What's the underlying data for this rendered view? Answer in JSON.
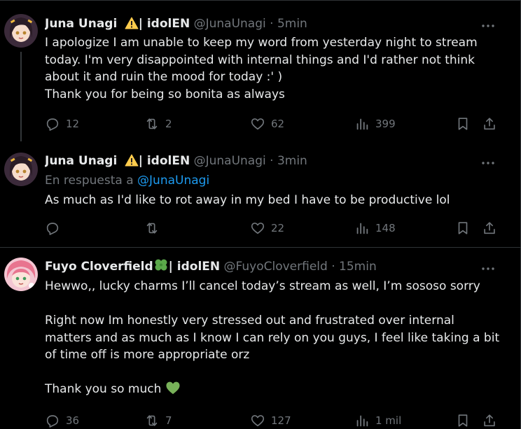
{
  "tweets": [
    {
      "name": "Juna Unagi",
      "name_suffix": "| idolEN",
      "handle": "@JunaUnagi",
      "dot": "·",
      "time": "5min",
      "lines": [
        "I apologize I am unable to keep my word from yesterday night to stream",
        "today. I'm very disappointed with internal things and I'd rather not think",
        "about it and ruin the mood for today :' )",
        "Thank you for being so bonita as always"
      ],
      "replies": "12",
      "retweets": "2",
      "likes": "62",
      "views": "399"
    },
    {
      "name": "Juna Unagi",
      "name_suffix": "| idolEN",
      "handle": "@JunaUnagi",
      "dot": "·",
      "time": "3min",
      "reply_prefix": "En respuesta a",
      "reply_handle": "@JunaUnagi",
      "lines": [
        "As much as I'd like to rot away in my bed I have to be productive lol"
      ],
      "replies": "",
      "retweets": "",
      "likes": "22",
      "views": "148"
    },
    {
      "name": "Fuyo Cloverfield",
      "name_suffix": "| idolEN",
      "handle": "@FuyoCloverfield",
      "dot": "·",
      "time": "15min",
      "line1": "Hewwo,, lucky charms I’ll cancel today’s stream as well, I’m sososo sorry",
      "line2": "Right now Im honestly very stressed out and frustrated over internal",
      "line3": "matters and as much as I know I can rely on you guys, I feel like taking a bit",
      "line4": "of time off is more appropriate orz",
      "line5": "Thank you so much",
      "replies": "36",
      "retweets": "7",
      "likes": "127",
      "views": "1 mil"
    }
  ],
  "colors": {
    "background": "#000000",
    "text": "#e7e9ea",
    "muted": "#71767b",
    "link": "#1d9bf0",
    "divider": "#2f3336"
  },
  "icons": [
    "reply-icon",
    "retweet-icon",
    "like-icon",
    "views-icon",
    "bookmark-icon",
    "share-icon",
    "more-icon",
    "warning-emoji",
    "four-leaf-clover-emoji",
    "green-heart-emoji"
  ]
}
